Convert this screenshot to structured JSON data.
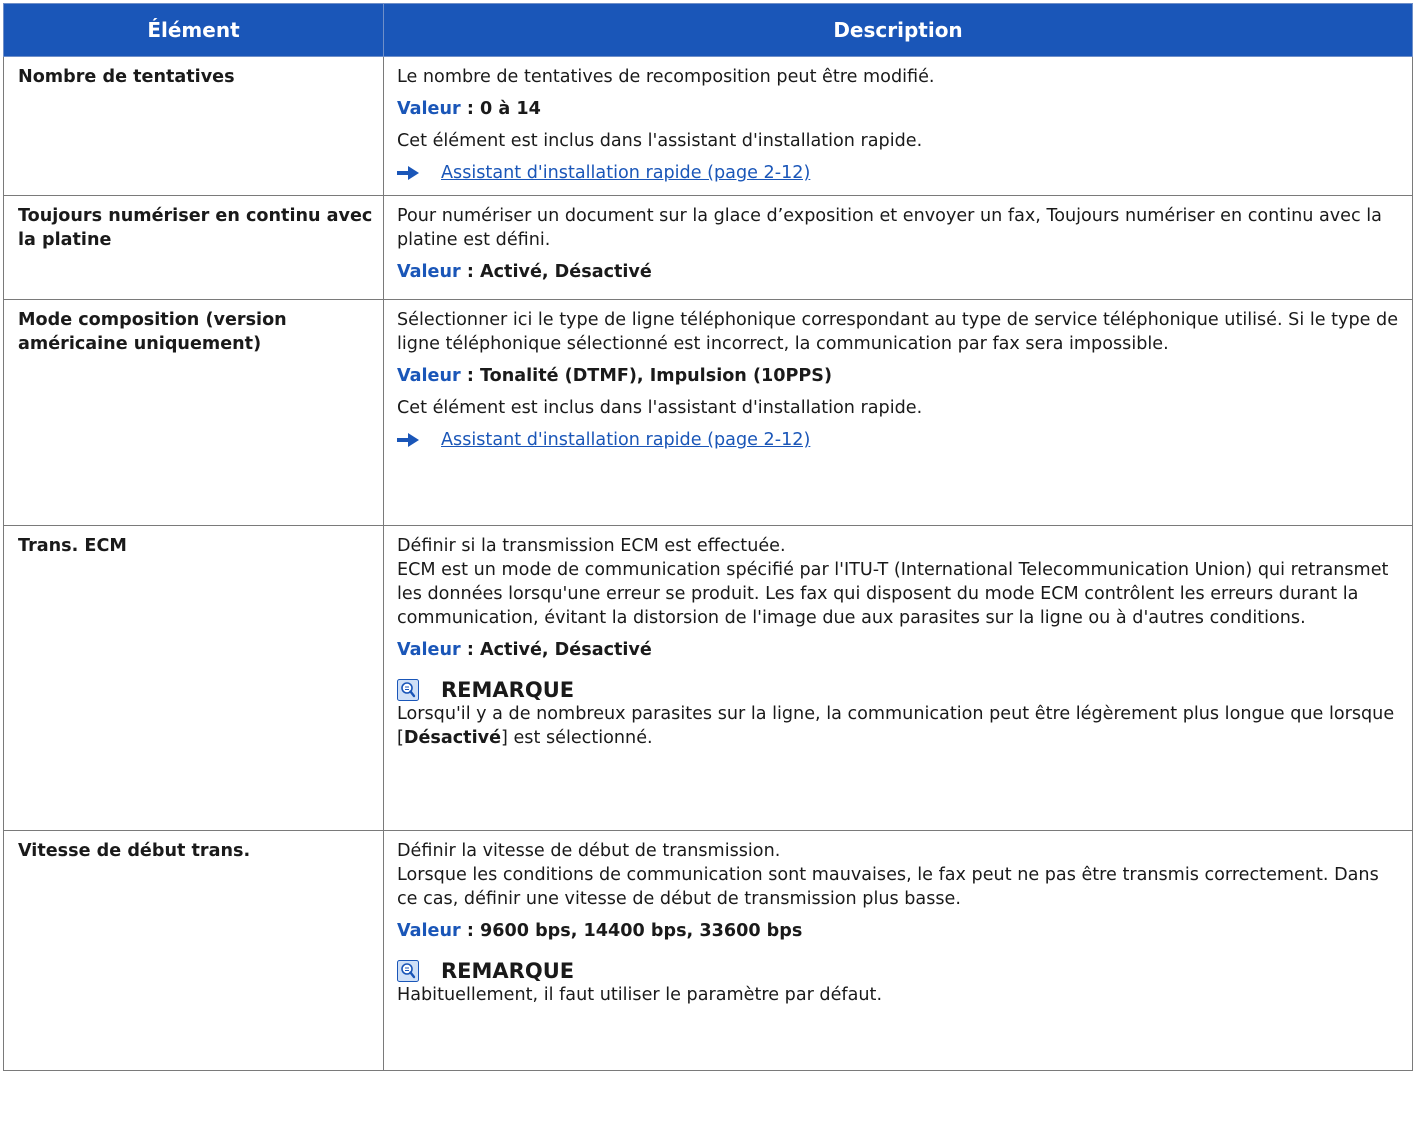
{
  "table": {
    "headers": [
      "Élément",
      "Description"
    ],
    "rows": [
      {
        "item": "Nombre de tentatives",
        "desc": "Le nombre de tentatives de recomposition peut être modifié.",
        "value_label": "Valeur",
        "value_text": " : 0 à 14",
        "extra": "Cet élément est inclus dans l'assistant d'installation rapide.",
        "link": "Assistant d'installation rapide (page 2-12)"
      },
      {
        "item": "Toujours numériser en continu avec la platine",
        "desc": "Pour numériser un document sur la glace d’exposition et envoyer un fax, Toujours numériser en continu avec la platine est défini.",
        "value_label": "Valeur",
        "value_text": " : Activé, Désactivé"
      },
      {
        "item": "Mode composition (version américaine uniquement)",
        "desc": "Sélectionner ici le type de ligne téléphonique correspondant au type de service téléphonique utilisé. Si le type de ligne téléphonique sélectionné est incorrect, la communication par fax sera impossible.",
        "value_label": "Valeur",
        "value_text": " : Tonalité (DTMF), Impulsion (10PPS)",
        "extra": "Cet élément est inclus dans l'assistant d'installation rapide.",
        "link": "Assistant d'installation rapide (page 2-12)"
      },
      {
        "item": "Trans. ECM",
        "desc": "Définir si la transmission ECM est effectuée.",
        "desc2": "ECM est un mode de communication spécifié par l'ITU-T (International Telecommunication Union) qui retransmet les données lorsqu'une erreur se produit. Les fax qui disposent du mode ECM contrôlent les erreurs durant la communication, évitant la distorsion de l'image due aux parasites sur la ligne ou à d'autres conditions.",
        "value_label": "Valeur",
        "value_text": " : Activé, Désactivé",
        "note_title": "REMARQUE",
        "note_pre": "Lorsqu'il y a de nombreux parasites sur la ligne, la communication peut être légèrement plus longue que lorsque [",
        "note_bold": "Désactivé",
        "note_post": "] est sélectionné."
      },
      {
        "item": "Vitesse de début trans.",
        "desc": "Définir la vitesse de début de transmission.",
        "desc2": "Lorsque les conditions de communication sont mauvaises, le fax peut ne pas être transmis correctement. Dans ce cas, définir une vitesse de début de transmission plus basse.",
        "value_label": "Valeur",
        "value_text": " : 9600 bps, 14400 bps, 33600 bps",
        "note_title": "REMARQUE",
        "note_text": "Habituellement, il faut utiliser le paramètre par défaut."
      }
    ]
  },
  "icons": {
    "link_arrow": "arrow-right-icon",
    "note": "lightbulb-note-icon"
  },
  "colors": {
    "header_bg": "#1a56b8",
    "accent": "#1a56b8",
    "border": "#7a7a7a"
  }
}
